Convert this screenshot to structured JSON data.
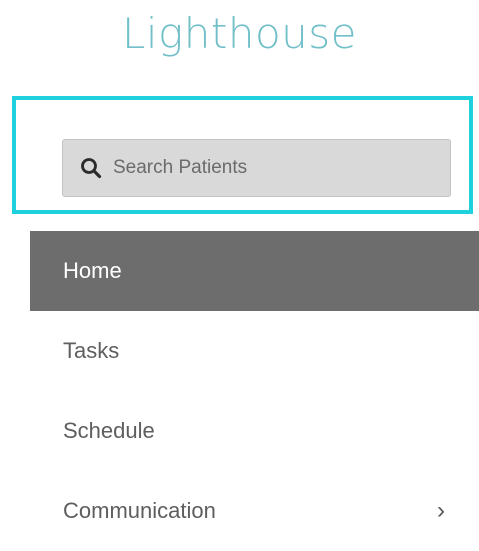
{
  "app": {
    "logo_text": "Lighthouse",
    "brand_color": "#71bfc9",
    "highlight_color": "#1fd1dd"
  },
  "search": {
    "placeholder": "Search Patients",
    "value": "",
    "icon": "search-icon"
  },
  "nav": {
    "active_color": "#6d6d6d",
    "items": [
      {
        "label": "Home",
        "active": true
      },
      {
        "label": "Tasks",
        "active": false
      },
      {
        "label": "Schedule",
        "active": false
      },
      {
        "label": "Communication",
        "active": false,
        "has_submenu": true,
        "submenu_icon": "chevron-right-icon",
        "submenu_glyph": "›"
      }
    ]
  }
}
